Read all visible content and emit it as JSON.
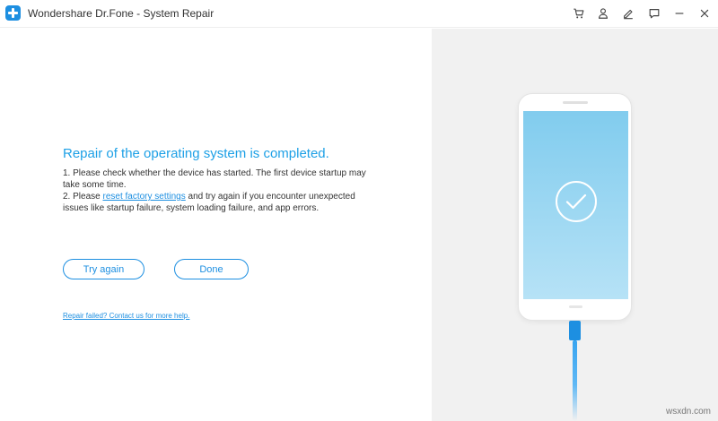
{
  "window": {
    "title": "Wondershare Dr.Fone - System Repair"
  },
  "titlebar_icons": [
    "cart-icon",
    "user-icon",
    "edit-icon",
    "feedback-icon",
    "minimize-icon",
    "close-icon"
  ],
  "main": {
    "heading": "Repair of the operating system is completed.",
    "line1": "1. Please check whether the device has started. The first device startup may take some time.",
    "line2_prefix": "2. Please ",
    "line2_link": "reset factory settings",
    "line2_suffix": " and try again if you encounter unexpected issues like startup failure, system loading failure, and app errors.",
    "try_again_label": "Try again",
    "done_label": "Done",
    "help_link": "Repair failed? Contact us for more help."
  },
  "watermark": "wsxdn.com",
  "colors": {
    "accent": "#1d8fe1",
    "heading": "#1da0e6",
    "right_panel": "#f1f1f1",
    "screen_top": "#81ccee",
    "screen_bottom": "#b6e2f6"
  }
}
